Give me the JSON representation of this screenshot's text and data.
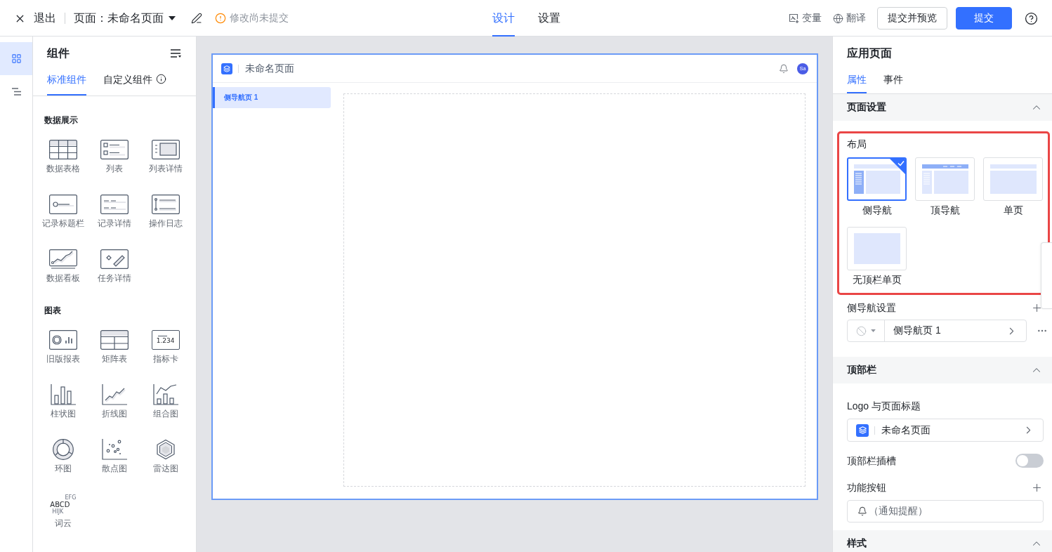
{
  "top_bar": {
    "exit_label": "退出",
    "page_title": "页面：未命名页面",
    "status": "修改尚未提交",
    "mode_tabs": [
      {
        "label": "设计",
        "selected": true
      },
      {
        "label": "设置",
        "selected": false
      }
    ],
    "tools": [
      {
        "kind": "variable",
        "label": "变量"
      },
      {
        "kind": "translate",
        "label": "翻译"
      }
    ],
    "buttons": [
      {
        "kind": "secondary",
        "label": "提交并预览"
      },
      {
        "kind": "primary",
        "label": "提交"
      }
    ]
  },
  "rail": {
    "items": [
      {
        "kind": "components",
        "selected": true
      },
      {
        "kind": "outline",
        "selected": false
      }
    ]
  },
  "component_panel": {
    "title": "组件",
    "tabs": [
      {
        "label": "标准组件",
        "selected": true
      },
      {
        "label": "自定义组件",
        "selected": false,
        "info_icon": true
      }
    ],
    "groups": [
      {
        "title": "数据展示",
        "items": [
          {
            "kind": "data_table",
            "label": "数据表格"
          },
          {
            "kind": "list",
            "label": "列表"
          },
          {
            "kind": "list_detail",
            "label": "列表详情"
          },
          {
            "kind": "record_header",
            "label": "记录标题栏"
          },
          {
            "kind": "record_detail",
            "label": "记录详情"
          },
          {
            "kind": "operation_log",
            "label": "操作日志"
          },
          {
            "kind": "dashboard",
            "label": "数据看板"
          },
          {
            "kind": "task_detail",
            "label": "任务详情"
          }
        ]
      },
      {
        "title": "图表",
        "items": [
          {
            "kind": "legacy_report",
            "label": "旧版报表"
          },
          {
            "kind": "matrix",
            "label": "矩阵表"
          },
          {
            "kind": "metric_card",
            "label": "指标卡",
            "icon_text": [
              "1.234"
            ]
          },
          {
            "kind": "bar_chart",
            "label": "柱状图"
          },
          {
            "kind": "line_chart",
            "label": "折线图"
          },
          {
            "kind": "combo_chart",
            "label": "组合图"
          },
          {
            "kind": "donut_chart",
            "label": "环图"
          },
          {
            "kind": "scatter_chart",
            "label": "散点图"
          },
          {
            "kind": "radar_chart",
            "label": "雷达图"
          },
          {
            "kind": "word_cloud",
            "label": "词云",
            "icon_text": [
              "EFG",
              "ABCD",
              "HIJK"
            ]
          }
        ]
      }
    ]
  },
  "canvas": {
    "app_title": "未命名页面",
    "avatar": "Sa",
    "nav_items": [
      {
        "label": "侧导航页 1",
        "selected": true
      }
    ]
  },
  "properties_panel": {
    "title": "应用页面",
    "tabs": [
      {
        "label": "属性",
        "selected": true
      },
      {
        "label": "事件",
        "selected": false
      }
    ],
    "page_settings": {
      "title": "页面设置",
      "expanded": true,
      "layout": {
        "label": "布局",
        "highlighted": true,
        "options": [
          {
            "kind": "side_nav",
            "label": "侧导航",
            "selected": true
          },
          {
            "kind": "top_nav",
            "label": "顶导航",
            "selected": false
          },
          {
            "kind": "single",
            "label": "单页",
            "selected": false
          },
          {
            "kind": "single_no_header",
            "label": "无顶栏单页",
            "selected": false
          }
        ]
      },
      "side_nav": {
        "label": "侧导航设置",
        "items": [
          {
            "label": "侧导航页 1"
          }
        ]
      }
    },
    "header_settings": {
      "title": "顶部栏",
      "expanded": true,
      "logo_title": {
        "label": "Logo 与页面标题",
        "value": "未命名页面"
      },
      "slot": {
        "label": "顶部栏插槽",
        "on": false
      },
      "function_buttons": {
        "label": "功能按钮",
        "items": [
          {
            "kind": "notification",
            "label": "（通知提醒）"
          }
        ]
      }
    },
    "style_settings": {
      "title": "样式",
      "expanded": true
    }
  }
}
